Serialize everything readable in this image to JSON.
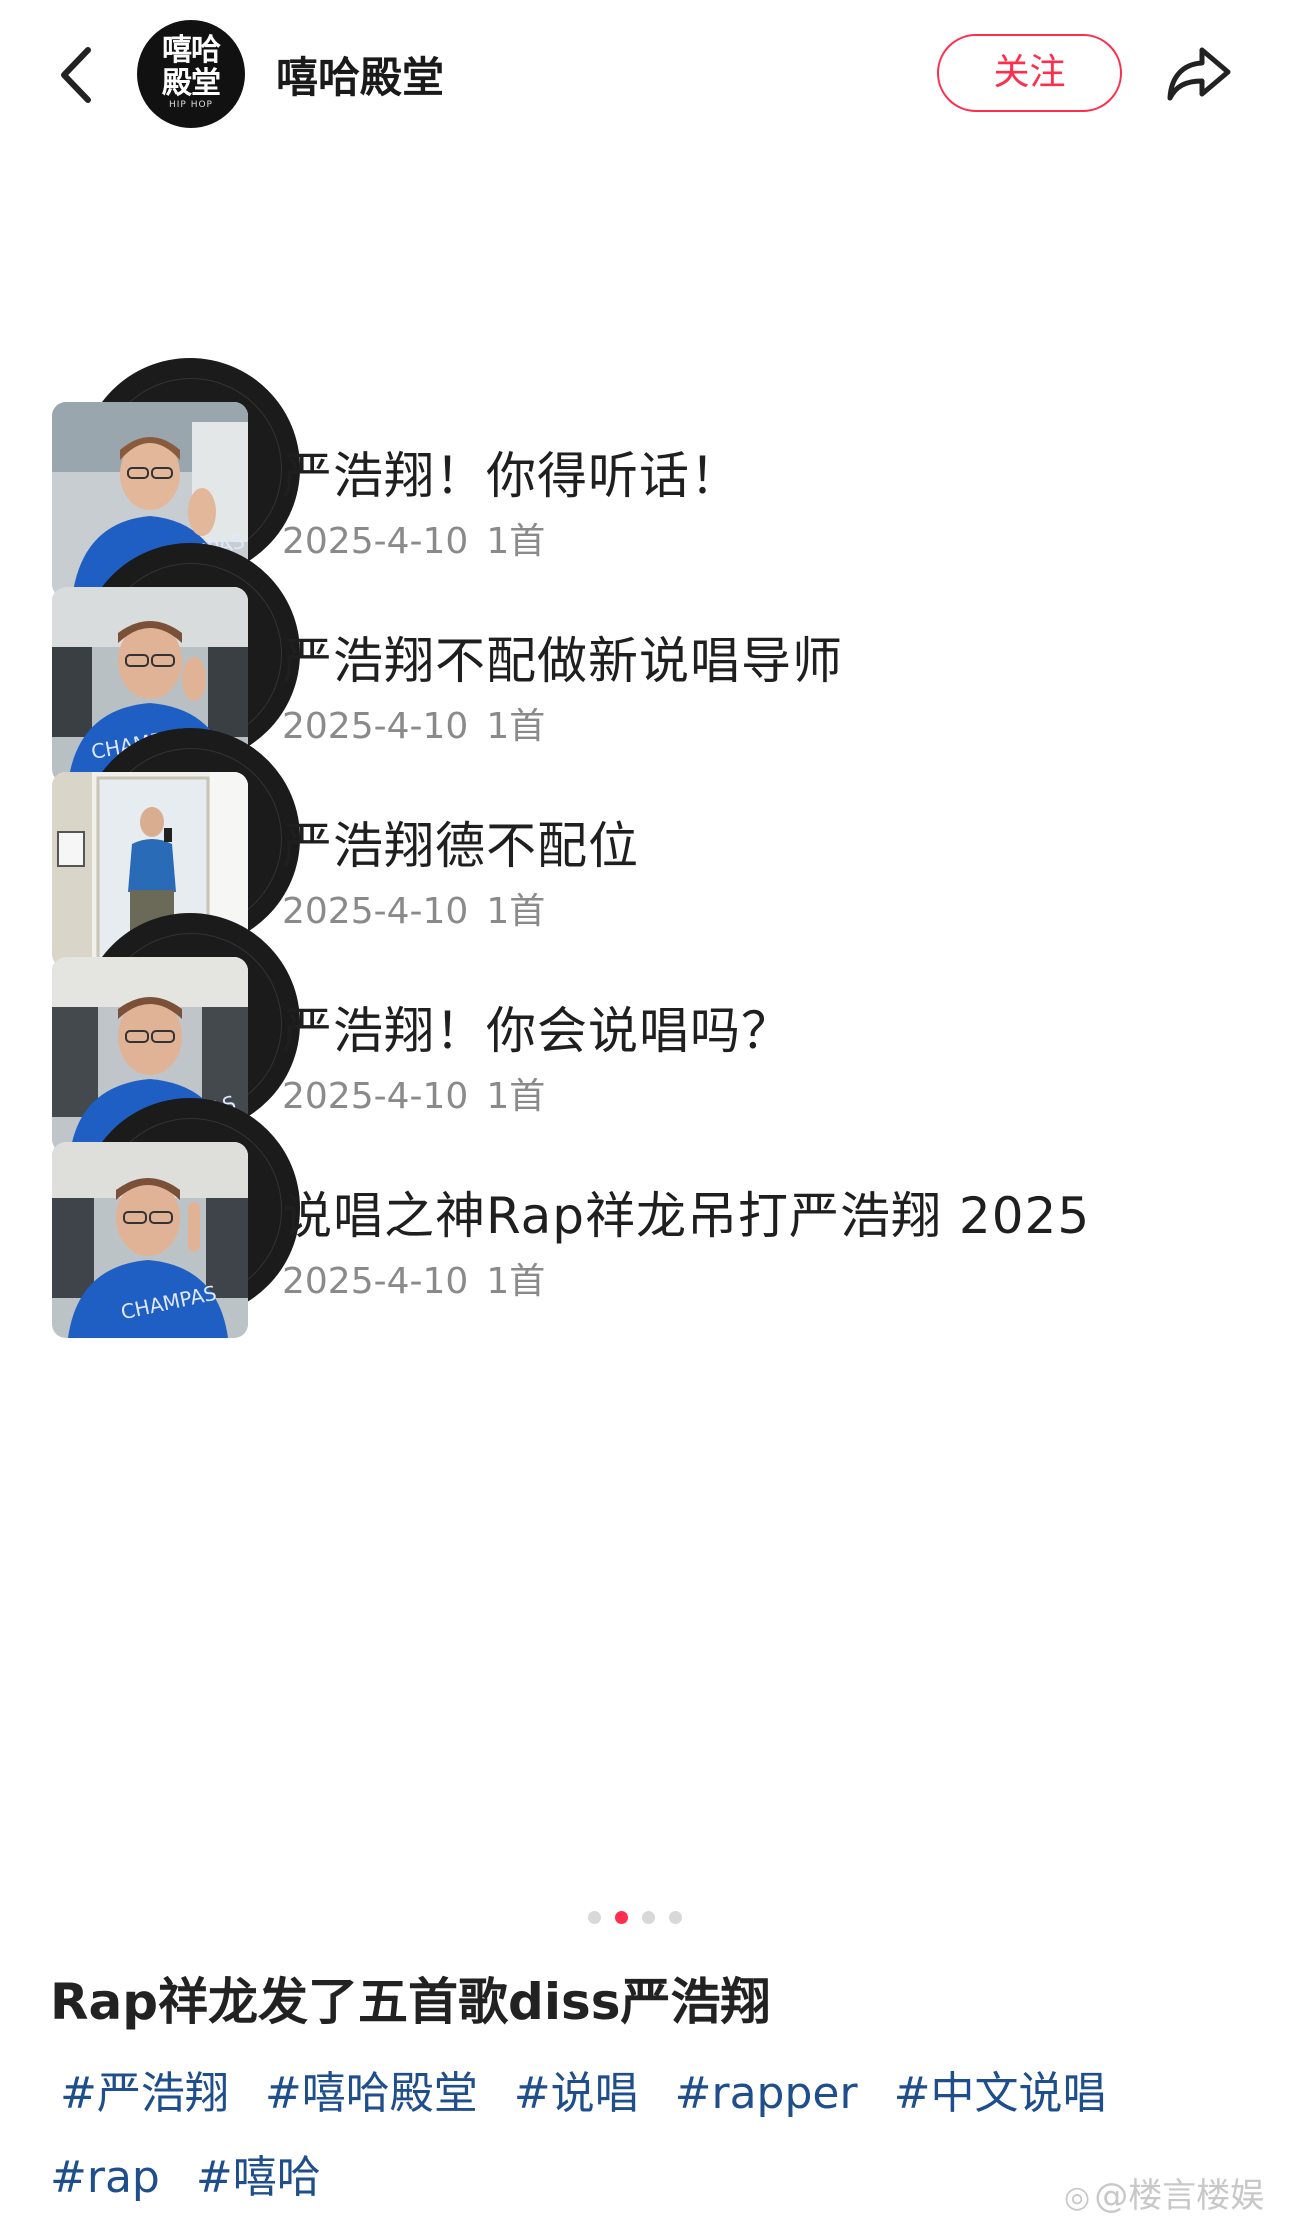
{
  "header": {
    "back_icon": "chevron-left-icon",
    "avatar_logo_text": "嘻哈殿堂",
    "avatar_logo_sub": "HIP HOP",
    "account_name": "嘻哈殿堂",
    "follow_label": "关注",
    "share_icon": "share-arrow-icon"
  },
  "songs": [
    {
      "title": "严浩翔！你得听话！",
      "date": "2025-4-10",
      "count": "1首"
    },
    {
      "title": "严浩翔不配做新说唱导师",
      "date": "2025-4-10",
      "count": "1首"
    },
    {
      "title": "严浩翔德不配位",
      "date": "2025-4-10",
      "count": "1首"
    },
    {
      "title": "严浩翔！你会说唱吗？",
      "date": "2025-4-10",
      "count": "1首"
    },
    {
      "title": "说唱之神Rap祥龙吊打严浩翔 2025",
      "date": "2025-4-10",
      "count": "1首"
    }
  ],
  "pagination": {
    "total": 4,
    "active_index": 1
  },
  "post": {
    "title": "Rap祥龙发了五首歌diss严浩翔",
    "tags": [
      "#严浩翔",
      "#嘻哈殿堂",
      "#说唱",
      "#rapper",
      "#中文说唱",
      "#rap",
      "#嘻哈"
    ]
  },
  "watermark": {
    "text": "@楼言楼娱",
    "icon": "weibo-icon"
  },
  "colors": {
    "accent": "#ff2e4d",
    "tag": "#1f4e8c",
    "meta": "#8a8a8a"
  }
}
